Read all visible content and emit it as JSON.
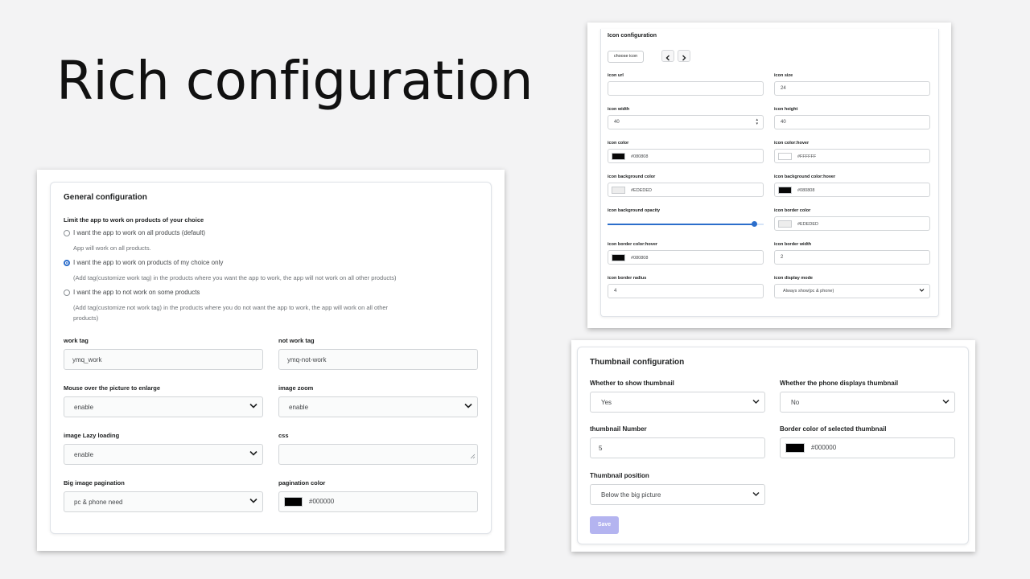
{
  "headline": "Rich configuration",
  "general": {
    "title": "General configuration",
    "limit_label": "Limit the app to work on products of your choice",
    "options": [
      {
        "label": "I want the app to work on all products (default)",
        "selected": false
      },
      {
        "label": "I want the app to work on products of my choice only",
        "selected": true
      },
      {
        "label": "I want the app to not work on some products",
        "selected": false
      }
    ],
    "help_all": "App will work on all products.",
    "help_choice": "(Add tag(customize work tag) in the products where you want the app to work, the app will not work on all other products)",
    "help_not_line1": "(Add tag(customize not work tag) in the products where you do not want the app to work, the app will work on all other",
    "help_not_line2": "products)",
    "work_tag_label": "work tag",
    "work_tag_value": "ymq_work",
    "not_work_tag_label": "not work tag",
    "not_work_tag_value": "ymq-not-work",
    "mouseover_label": "Mouse over the picture to enlarge",
    "mouseover_value": "enable",
    "image_zoom_label": "image zoom",
    "image_zoom_value": "enable",
    "lazy_label": "image Lazy loading",
    "lazy_value": "enable",
    "css_label": "css",
    "pagination_label": "Big image pagination",
    "pagination_value": "pc & phone need",
    "pagination_color_label": "pagination color",
    "pagination_color_value": "#000000"
  },
  "icon": {
    "title": "Icon configuration",
    "choose_icon": "choose icon",
    "prev": "‹",
    "next": "›",
    "url_label": "icon url",
    "url_value": "",
    "size_label": "icon size",
    "size_value": "24",
    "width_label": "icon width",
    "width_value": "40",
    "height_label": "icon height",
    "height_value": "40",
    "color_label": "icon color",
    "color_value": "#080808",
    "color_hover_label": "icon color:hover",
    "color_hover_value": "#FFFFFF",
    "bg_label": "icon background color",
    "bg_value": "#EDEDED",
    "bg_hover_label": "icon background color:hover",
    "bg_hover_value": "#080808",
    "opacity_label": "icon background opacity",
    "opacity_fraction": 0.94,
    "border_color_label": "icon border color",
    "border_color_value": "#EDEDED",
    "border_hover_label": "icon border color:hover",
    "border_hover_value": "#080808",
    "border_width_label": "icon border width",
    "border_width_value": "2",
    "radius_label": "icon border radius",
    "radius_value": "4",
    "display_label": "icon display mode",
    "display_value": "Always show(pc & phone)"
  },
  "thumb": {
    "title": "Thumbnail configuration",
    "show_label": "Whether to show thumbnail",
    "show_value": "Yes",
    "phone_label": "Whether the phone displays thumbnail",
    "phone_value": "No",
    "number_label": "thumbnail Number",
    "number_value": "5",
    "border_label": "Border color of selected thumbnail",
    "border_value": "#000000",
    "position_label": "Thumbnail position",
    "position_value": "Below the big picture",
    "save": "Save"
  },
  "colors": {
    "accent": "#2c6ecb",
    "save_bg": "#b4b4f0",
    "black_swatch": "#000000",
    "dark_swatch": "#080808",
    "light_swatch": "#EDEDED",
    "white_swatch": "#FFFFFF"
  }
}
